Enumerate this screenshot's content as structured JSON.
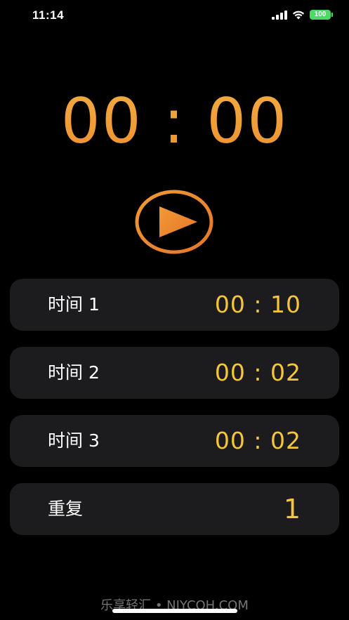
{
  "status_bar": {
    "time": "11:14",
    "battery_level": "100",
    "battery_color": "#4cd964"
  },
  "timer": {
    "display": "00 : 00",
    "color": "#f0a83c"
  },
  "play_button": {
    "icon": "play-icon",
    "color": "#ee8a2a"
  },
  "rows": [
    {
      "label": "时间 1",
      "value": "00 : 10"
    },
    {
      "label": "时间 2",
      "value": "00 : 02"
    },
    {
      "label": "时间 3",
      "value": "00 : 02"
    },
    {
      "label": "重复",
      "value": "1"
    }
  ],
  "watermark": "乐享轻汇 • NJYCOH.COM",
  "colors": {
    "background": "#000000",
    "row_background": "#1c1c1e",
    "value_color": "#f5c63a"
  }
}
